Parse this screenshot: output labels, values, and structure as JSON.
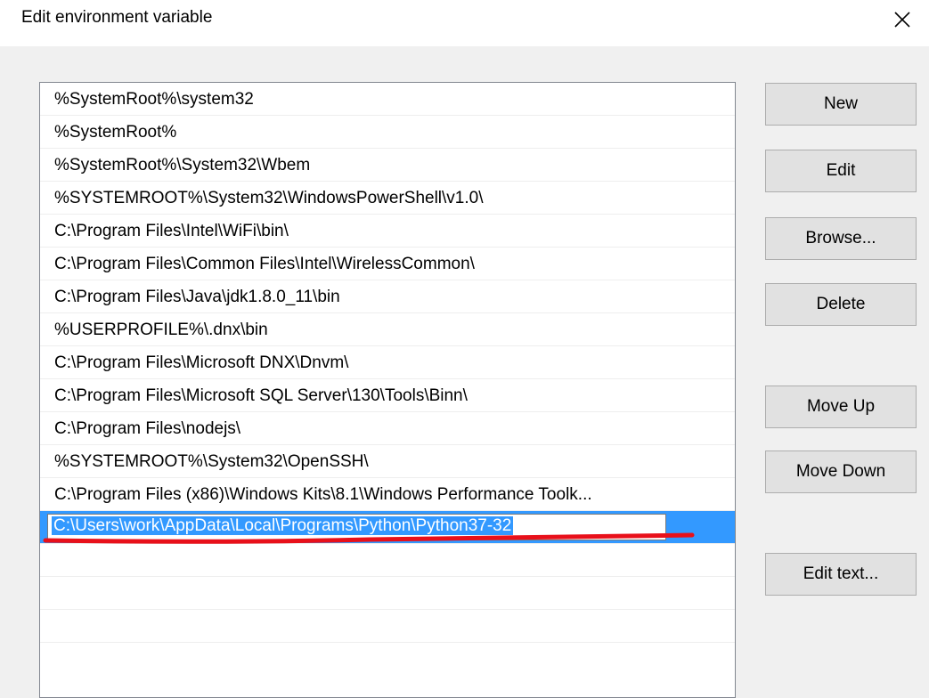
{
  "window": {
    "title": "Edit environment variable",
    "close_icon": "close-icon"
  },
  "path_list": {
    "items": [
      "%SystemRoot%\\system32",
      "%SystemRoot%",
      "%SystemRoot%\\System32\\Wbem",
      "%SYSTEMROOT%\\System32\\WindowsPowerShell\\v1.0\\",
      "C:\\Program Files\\Intel\\WiFi\\bin\\",
      "C:\\Program Files\\Common Files\\Intel\\WirelessCommon\\",
      "C:\\Program Files\\Java\\jdk1.8.0_11\\bin",
      "%USERPROFILE%\\.dnx\\bin",
      "C:\\Program Files\\Microsoft DNX\\Dnvm\\",
      "C:\\Program Files\\Microsoft SQL Server\\130\\Tools\\Binn\\",
      "C:\\Program Files\\nodejs\\",
      "%SYSTEMROOT%\\System32\\OpenSSH\\",
      "C:\\Program Files (x86)\\Windows Kits\\8.1\\Windows Performance Toolk..."
    ],
    "editing_value": "C:\\Users\\work\\AppData\\Local\\Programs\\Python\\Python37-32"
  },
  "buttons": {
    "new": "New",
    "edit": "Edit",
    "browse": "Browse...",
    "delete": "Delete",
    "move_up": "Move Up",
    "move_down": "Move Down",
    "edit_text": "Edit text..."
  },
  "colors": {
    "selection": "#3399ff",
    "annotation": "#e8101a"
  }
}
